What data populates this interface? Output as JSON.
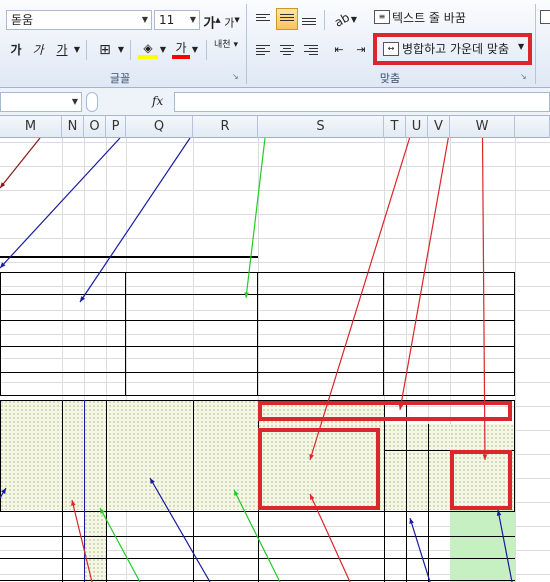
{
  "ribbon": {
    "font_name": "돋움",
    "font_size": "11",
    "grow_font": "가",
    "shrink_font": "가",
    "bold": "가",
    "italic": "가",
    "underline": "가",
    "font_color_glyph": "가",
    "phonetic": "내천",
    "wrap_text_label": "텍스트 줄 바꿈",
    "merge_center_label": "병합하고 가운데 맞춤",
    "group_font_label": "글꼴",
    "group_align_label": "맞춤",
    "colors": {
      "highlight": "#ffff00",
      "font_color": "#ff0000",
      "callout_red": "#d9272b"
    }
  },
  "formula_bar": {
    "fx": "fx",
    "name_box": ""
  },
  "columns": [
    "M",
    "N",
    "O",
    "P",
    "Q",
    "R",
    "S",
    "T",
    "U",
    "V",
    "W"
  ]
}
